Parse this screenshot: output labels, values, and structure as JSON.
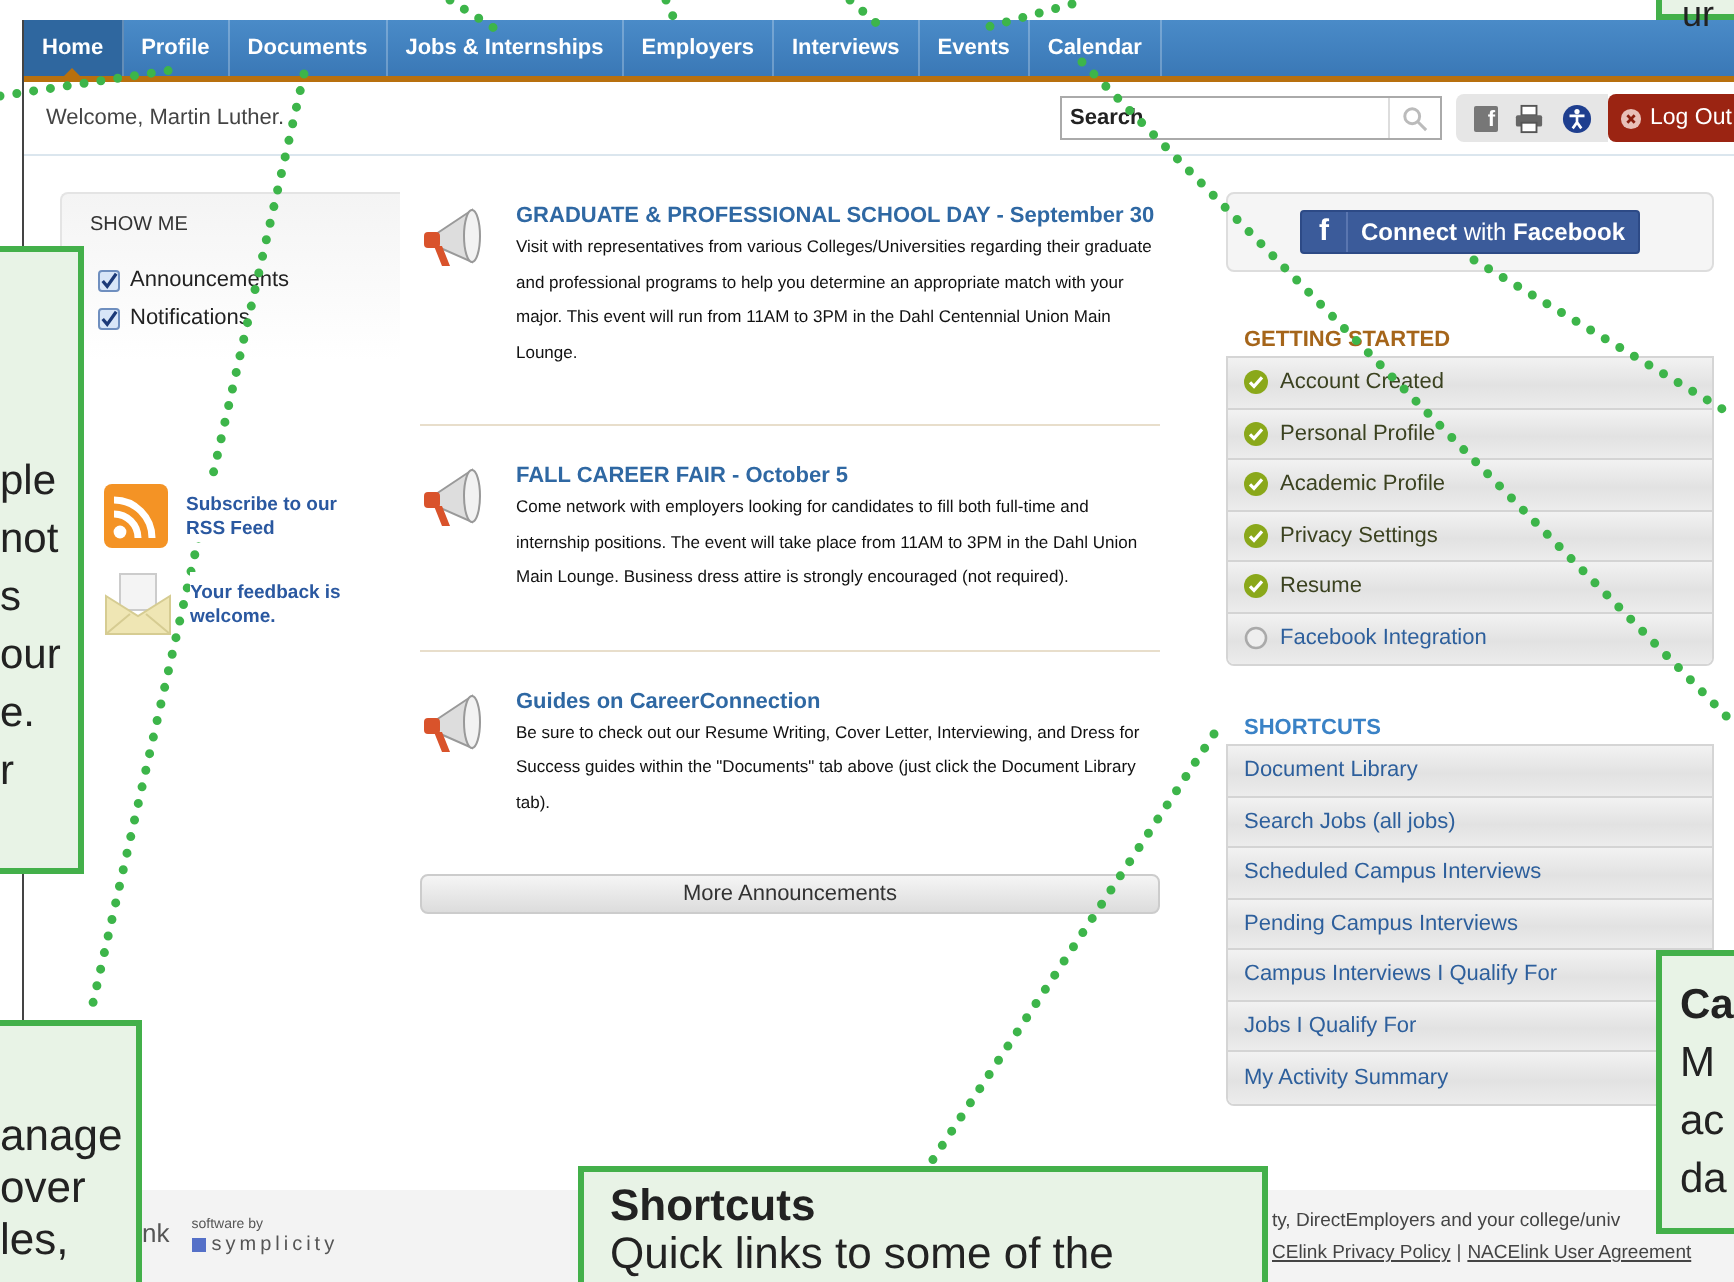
{
  "nav": {
    "tabs": [
      {
        "label": "Home",
        "selected": true
      },
      {
        "label": "Profile",
        "selected": false
      },
      {
        "label": "Documents",
        "selected": false
      },
      {
        "label": "Jobs & Internships",
        "selected": false
      },
      {
        "label": "Employers",
        "selected": false
      },
      {
        "label": "Interviews",
        "selected": false
      },
      {
        "label": "Events",
        "selected": false
      },
      {
        "label": "Calendar",
        "selected": false
      }
    ]
  },
  "header": {
    "welcome": "Welcome, Martin Luther.",
    "search": {
      "value": "Search"
    },
    "share_letter": "f",
    "logout": "Log Out"
  },
  "show_me": {
    "title": "SHOW ME",
    "filters": [
      {
        "label": "Announcements",
        "checked": true
      },
      {
        "label": "Notifications",
        "checked": true
      }
    ]
  },
  "side_links": [
    {
      "kind": "rss",
      "text": "Subscribe to our RSS Feed"
    },
    {
      "kind": "feedback",
      "text": "Your feedback is welcome."
    }
  ],
  "announcements": [
    {
      "title": "GRADUATE & PROFESSIONAL SCHOOL DAY - September 30",
      "body": "Visit with representatives from various Colleges/Universities regarding their graduate and professional programs to help you determine an appropriate match with your major.  This event will run from 11AM to 3PM in the Dahl Centennial Union Main Lounge."
    },
    {
      "title": "FALL CAREER FAIR - October 5",
      "body": "Come network with employers looking for candidates to fill both full-time and internship positions.  The event will take place from 11AM to 3PM in the Dahl Union Main Lounge.  Business dress attire is strongly encouraged (not required)."
    },
    {
      "title": "Guides on CareerConnection",
      "body": "Be sure to check out our Resume Writing, Cover Letter, Interviewing, and Dress for Success guides within the \"Documents\" tab above (just click the Document Library tab)."
    }
  ],
  "more_button": "More Announcements",
  "facebook_button": {
    "letter": "f",
    "label": "**Connect** with **Facebook**"
  },
  "getting_started": {
    "title": "GETTING STARTED",
    "items": [
      {
        "label": "Account Created",
        "done": true
      },
      {
        "label": "Personal Profile",
        "done": true
      },
      {
        "label": "Academic Profile",
        "done": true
      },
      {
        "label": "Privacy Settings",
        "done": true
      },
      {
        "label": "Resume",
        "done": true
      },
      {
        "label": "Facebook Integration",
        "done": false
      }
    ]
  },
  "shortcuts": {
    "title": "SHORTCUTS",
    "items": [
      "Document Library",
      "Search Jobs (all jobs)",
      "Scheduled Campus Interviews",
      "Pending Campus Interviews",
      "Campus Interviews I Qualify For",
      "Jobs I Qualify For",
      "My Activity Summary"
    ]
  },
  "footer": {
    "logo_fragment": "nk",
    "software_by": "software by",
    "brand": "symplicity",
    "text": "ty, DirectEmployers and your college/univ",
    "links": [
      "CElink Privacy Policy",
      "NACElink User Agreement"
    ],
    "separator": "|"
  },
  "callouts": [
    {
      "lines": [
        "ur"
      ]
    },
    {
      "lines": [
        "ple",
        "not",
        "s",
        "our",
        "e.",
        "r"
      ]
    },
    {
      "lines": [
        "anage",
        "over",
        "les,"
      ]
    },
    {
      "title": "Shortcuts",
      "lines": [
        "Quick links to some of the"
      ]
    },
    {
      "title": "Ca",
      "lines": [
        "M",
        "ac",
        "da"
      ]
    }
  ]
}
